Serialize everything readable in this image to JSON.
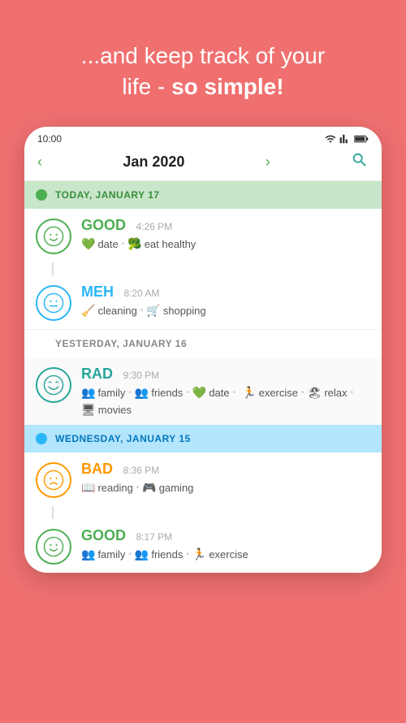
{
  "hero": {
    "line1": "...and keep track of your",
    "line2": "life - ",
    "bold": "so simple!"
  },
  "status_bar": {
    "time": "10:00"
  },
  "nav": {
    "month": "Jan 2020",
    "prev": "‹",
    "next": "›"
  },
  "days": [
    {
      "id": "today",
      "label": "TODAY, JANUARY 17",
      "dot_color": "green",
      "type": "today",
      "entries": [
        {
          "mood": "GOOD",
          "mood_color": "green",
          "face": "happy",
          "time": "4:26 PM",
          "tags": [
            {
              "icon": "💚",
              "label": "date"
            },
            {
              "icon": "🥦",
              "label": "eat healthy"
            }
          ]
        },
        {
          "mood": "MEH",
          "mood_color": "blue",
          "face": "meh",
          "time": "8:20 AM",
          "tags": [
            {
              "icon": "🧹",
              "label": "cleaning"
            },
            {
              "icon": "🛒",
              "label": "shopping"
            }
          ]
        }
      ]
    },
    {
      "id": "yesterday",
      "label": "YESTERDAY, JANUARY 16",
      "dot_color": null,
      "type": "yesterday",
      "entries": [
        {
          "mood": "RAD",
          "mood_color": "teal",
          "face": "rad",
          "time": "9:30 PM",
          "tags": [
            {
              "icon": "👥",
              "label": "family"
            },
            {
              "icon": "👥",
              "label": "friends"
            },
            {
              "icon": "💚",
              "label": "date"
            },
            {
              "icon": "🏃",
              "label": "exercise"
            },
            {
              "icon": "🏖",
              "label": "relax"
            },
            {
              "icon": "🖥",
              "label": "movies"
            }
          ]
        }
      ]
    },
    {
      "id": "wednesday",
      "label": "WEDNESDAY, JANUARY 15",
      "dot_color": "blue",
      "type": "wednesday",
      "entries": [
        {
          "mood": "BAD",
          "mood_color": "orange",
          "face": "bad",
          "time": "8:36 PM",
          "tags": [
            {
              "icon": "📖",
              "label": "reading"
            },
            {
              "icon": "🎮",
              "label": "gaming"
            }
          ]
        },
        {
          "mood": "GOOD",
          "mood_color": "green",
          "face": "happy",
          "time": "8:17 PM",
          "tags": [
            {
              "icon": "👥",
              "label": "family"
            },
            {
              "icon": "👥",
              "label": "friends"
            },
            {
              "icon": "🏃",
              "label": "exercise"
            }
          ]
        }
      ]
    }
  ]
}
